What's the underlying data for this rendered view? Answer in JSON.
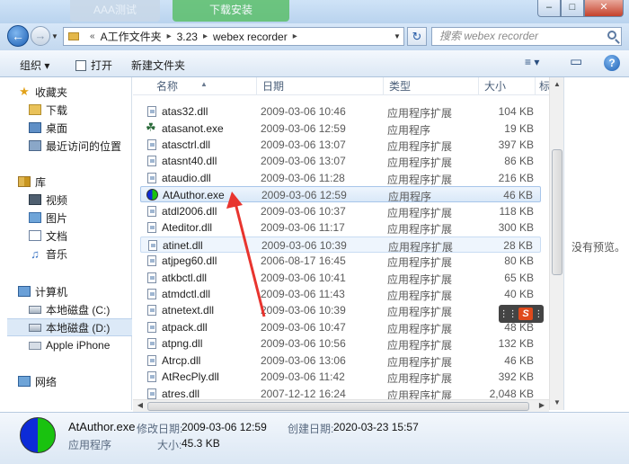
{
  "window": {
    "ghost_tab_1": "AAA测试",
    "ghost_tab_2": "下载安装",
    "min_glyph": "–",
    "max_glyph": "□",
    "close_glyph": "✕"
  },
  "address": {
    "breadcrumb": [
      "A工作文件夹",
      "3.23",
      "webex recorder"
    ],
    "search_placeholder": "搜索 webex recorder"
  },
  "toolbar": {
    "organize": "组织 ▾",
    "open": "打开",
    "new_folder": "新建文件夹",
    "view_icon": "≡ ▾",
    "pane_icon": "▭",
    "help": "?"
  },
  "nav": {
    "favorites": "收藏夹",
    "downloads": "下载",
    "desktop": "桌面",
    "recent": "最近访问的位置",
    "library": "库",
    "video": "视频",
    "pictures": "图片",
    "documents": "文档",
    "music": "音乐",
    "computer": "计算机",
    "drive_c": "本地磁盘 (C:)",
    "drive_d": "本地磁盘 (D:)",
    "iphone": "Apple iPhone",
    "network": "网络"
  },
  "columns": {
    "name": "名称",
    "date": "日期",
    "type": "类型",
    "size": "大小",
    "tag": "标"
  },
  "files": [
    {
      "name": "atas32.dll",
      "date": "2009-03-06 10:46",
      "type": "应用程序扩展",
      "size": "104 KB",
      "icon": "dll-icon"
    },
    {
      "name": "atasanot.exe",
      "date": "2009-03-06 12:59",
      "type": "应用程序",
      "size": "19 KB",
      "icon": "exe-icon"
    },
    {
      "name": "atasctrl.dll",
      "date": "2009-03-06 13:07",
      "type": "应用程序扩展",
      "size": "397 KB",
      "icon": "dll-icon"
    },
    {
      "name": "atasnt40.dll",
      "date": "2009-03-06 13:07",
      "type": "应用程序扩展",
      "size": "86 KB",
      "icon": "dll-icon"
    },
    {
      "name": "ataudio.dll",
      "date": "2009-03-06 11:28",
      "type": "应用程序扩展",
      "size": "216 KB",
      "icon": "dll-icon"
    },
    {
      "name": "AtAuthor.exe",
      "date": "2009-03-06 12:59",
      "type": "应用程序",
      "size": "46 KB",
      "icon": "exe-icon"
    },
    {
      "name": "atdl2006.dll",
      "date": "2009-03-06 10:37",
      "type": "应用程序扩展",
      "size": "118 KB",
      "icon": "dll-icon"
    },
    {
      "name": "Ateditor.dll",
      "date": "2009-03-06 11:17",
      "type": "应用程序扩展",
      "size": "300 KB",
      "icon": "dll-icon"
    },
    {
      "name": "atinet.dll",
      "date": "2009-03-06 10:39",
      "type": "应用程序扩展",
      "size": "28 KB",
      "icon": "dll-icon"
    },
    {
      "name": "atjpeg60.dll",
      "date": "2006-08-17 16:45",
      "type": "应用程序扩展",
      "size": "80 KB",
      "icon": "dll-icon"
    },
    {
      "name": "atkbctl.dll",
      "date": "2009-03-06 10:41",
      "type": "应用程序扩展",
      "size": "65 KB",
      "icon": "dll-icon"
    },
    {
      "name": "atmdctl.dll",
      "date": "2009-03-06 11:43",
      "type": "应用程序扩展",
      "size": "40 KB",
      "icon": "dll-icon"
    },
    {
      "name": "atnetext.dll",
      "date": "2009-03-06 10:39",
      "type": "应用程序扩展",
      "size": "",
      "icon": "dll-icon"
    },
    {
      "name": "atpack.dll",
      "date": "2009-03-06 10:47",
      "type": "应用程序扩展",
      "size": "48 KB",
      "icon": "dll-icon"
    },
    {
      "name": "atpng.dll",
      "date": "2009-03-06 10:56",
      "type": "应用程序扩展",
      "size": "132 KB",
      "icon": "dll-icon"
    },
    {
      "name": "Atrcp.dll",
      "date": "2009-03-06 13:06",
      "type": "应用程序扩展",
      "size": "46 KB",
      "icon": "dll-icon"
    },
    {
      "name": "AtRecPly.dll",
      "date": "2009-03-06 11:42",
      "type": "应用程序扩展",
      "size": "392 KB",
      "icon": "dll-icon"
    },
    {
      "name": "atres.dll",
      "date": "2007-12-12 16:24",
      "type": "应用程序扩展",
      "size": "2,048 KB",
      "icon": "dll-icon"
    }
  ],
  "preview": {
    "empty_text": "没有预览。"
  },
  "details": {
    "name": "AtAuthor.exe",
    "modified_label": "修改日期:",
    "modified_value": "2009-03-06 12:59",
    "created_label": "创建日期:",
    "created_value": "2020-03-23 15:57",
    "type": "应用程序",
    "size_label": "大小:",
    "size_value": "45.3 KB"
  },
  "ime": {
    "logo": "S"
  },
  "colors": {
    "selection": "#d9e8f8",
    "annotation_arrow": "#e8342e",
    "exe_blue": "#0d2bd8",
    "exe_green": "#19c20f"
  }
}
